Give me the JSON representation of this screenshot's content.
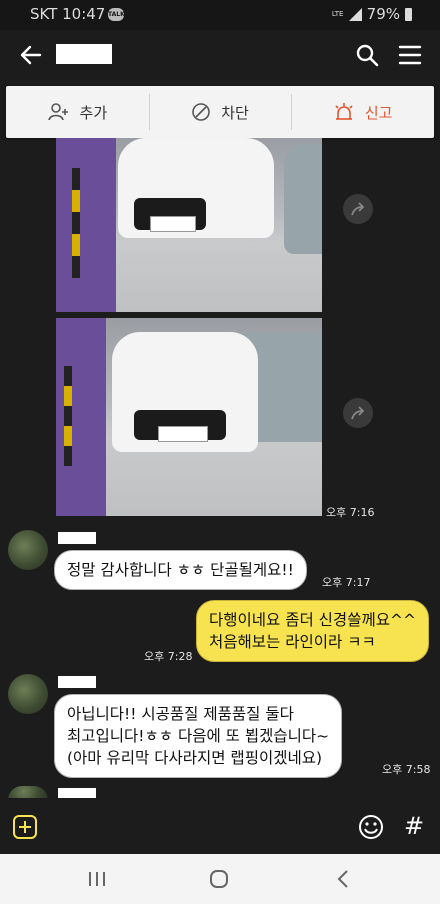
{
  "status": {
    "carrier": "SKT 10:47",
    "network": "LTE",
    "battery": "79%"
  },
  "header": {
    "contact_name_hidden": ""
  },
  "actions": [
    {
      "label": "추가",
      "icon": "add-friend-icon"
    },
    {
      "label": "차단",
      "icon": "block-icon"
    },
    {
      "label": "신고",
      "icon": "report-siren-icon"
    }
  ],
  "photos": {
    "time": "오후 7:16"
  },
  "messages": [
    {
      "side": "left",
      "text": "정말 감사합니다 ㅎㅎ 단골될게요!!",
      "time": "오후 7:17"
    },
    {
      "side": "right",
      "lines": [
        "다행이네요 좀더 신경쓸께요^^",
        "처음해보는 라인이라  ㅋㅋ"
      ],
      "time": "오후 7:28"
    },
    {
      "side": "left",
      "lines": [
        "아닙니다!! 시공품질 제품품질 둘다",
        "최고입니다!ㅎㅎ 다음에 또 뵙겠습니다~",
        "(아마 유리막 다사라지면 랩핑이겠네요)"
      ],
      "time": "오후 7:58"
    }
  ],
  "composer": {
    "attach_icon": "plus-square-icon",
    "emoji_icon": "emoji-icon",
    "hash_icon": "#"
  },
  "colors": {
    "accent_yellow": "#f7e34f",
    "report_red": "#e0552f",
    "background": "#1c1c1c"
  }
}
